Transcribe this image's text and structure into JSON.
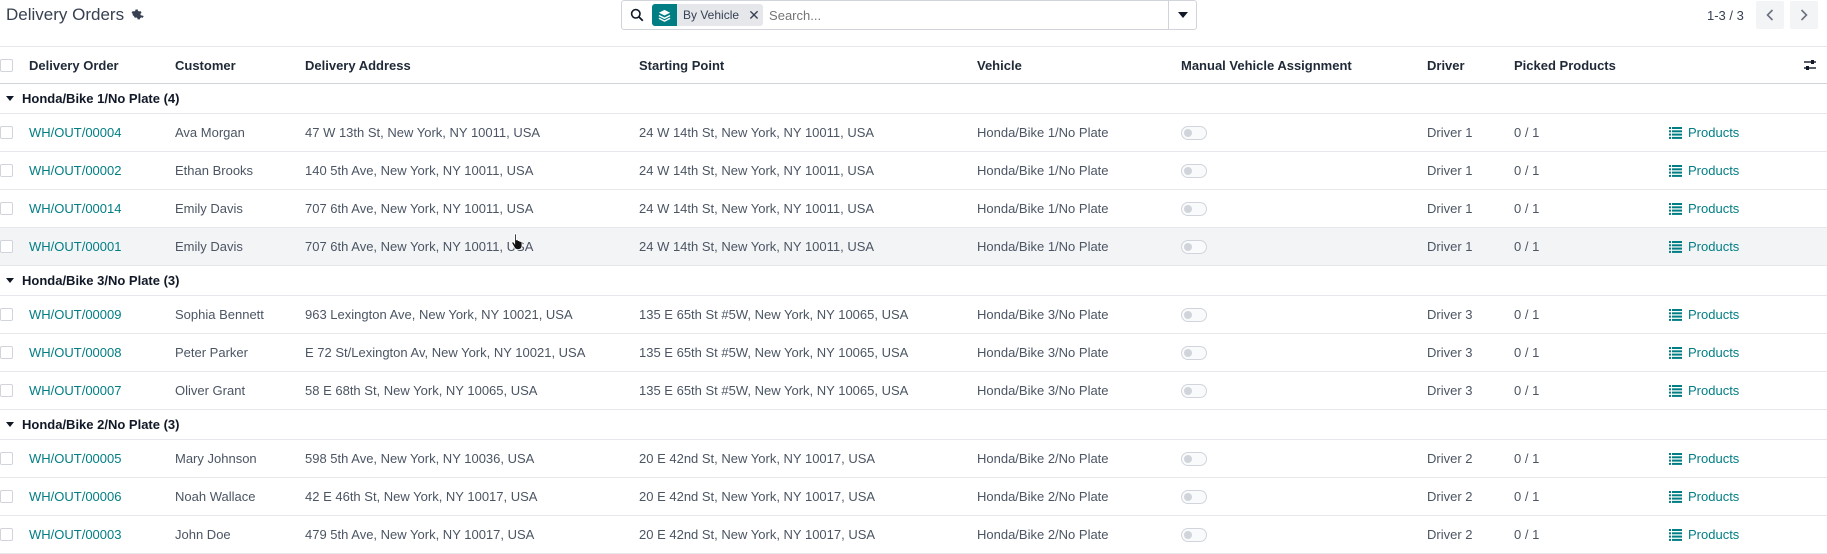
{
  "control_panel": {
    "title": "Delivery Orders",
    "search": {
      "facet_label": "By Vehicle",
      "placeholder": "Search..."
    },
    "pager": {
      "counter": "1-3 / 3"
    }
  },
  "columns": {
    "delivery_order": "Delivery Order",
    "customer": "Customer",
    "delivery_address": "Delivery Address",
    "starting_point": "Starting Point",
    "vehicle": "Vehicle",
    "manual_vehicle_assignment": "Manual Vehicle Assignment",
    "driver": "Driver",
    "picked_products": "Picked Products"
  },
  "groups": [
    {
      "label": "Honda/Bike 1/No Plate (4)",
      "rows": [
        {
          "ref": "WH/OUT/00004",
          "customer": "Ava Morgan",
          "address": "47 W 13th St, New York, NY 10011, USA",
          "start": "24 W 14th St, New York, NY 10011, USA",
          "vehicle": "Honda/Bike 1/No Plate",
          "driver": "Driver 1",
          "picked": "0 / 1",
          "products": "Products"
        },
        {
          "ref": "WH/OUT/00002",
          "customer": "Ethan Brooks",
          "address": "140 5th Ave, New York, NY 10011, USA",
          "start": "24 W 14th St, New York, NY 10011, USA",
          "vehicle": "Honda/Bike 1/No Plate",
          "driver": "Driver 1",
          "picked": "0 / 1",
          "products": "Products"
        },
        {
          "ref": "WH/OUT/00014",
          "customer": "Emily Davis",
          "address": "707 6th Ave, New York, NY 10011, USA",
          "start": "24 W 14th St, New York, NY 10011, USA",
          "vehicle": "Honda/Bike 1/No Plate",
          "driver": "Driver 1",
          "picked": "0 / 1",
          "products": "Products"
        },
        {
          "ref": "WH/OUT/00001",
          "customer": "Emily Davis",
          "address": "707 6th Ave, New York, NY 10011, USA",
          "start": "24 W 14th St, New York, NY 10011, USA",
          "vehicle": "Honda/Bike 1/No Plate",
          "driver": "Driver 1",
          "picked": "0 / 1",
          "products": "Products"
        }
      ]
    },
    {
      "label": "Honda/Bike 3/No Plate (3)",
      "rows": [
        {
          "ref": "WH/OUT/00009",
          "customer": "Sophia Bennett",
          "address": "963 Lexington Ave, New York, NY 10021, USA",
          "start": "135 E 65th St #5W, New York, NY 10065, USA",
          "vehicle": "Honda/Bike 3/No Plate",
          "driver": "Driver 3",
          "picked": "0 / 1",
          "products": "Products"
        },
        {
          "ref": "WH/OUT/00008",
          "customer": "Peter Parker",
          "address": "E 72 St/Lexington Av, New York, NY 10021, USA",
          "start": "135 E 65th St #5W, New York, NY 10065, USA",
          "vehicle": "Honda/Bike 3/No Plate",
          "driver": "Driver 3",
          "picked": "0 / 1",
          "products": "Products"
        },
        {
          "ref": "WH/OUT/00007",
          "customer": "Oliver Grant",
          "address": "58 E 68th St, New York, NY 10065, USA",
          "start": "135 E 65th St #5W, New York, NY 10065, USA",
          "vehicle": "Honda/Bike 3/No Plate",
          "driver": "Driver 3",
          "picked": "0 / 1",
          "products": "Products"
        }
      ]
    },
    {
      "label": "Honda/Bike 2/No Plate (3)",
      "rows": [
        {
          "ref": "WH/OUT/00005",
          "customer": "Mary Johnson",
          "address": "598 5th Ave, New York, NY 10036, USA",
          "start": "20 E 42nd St, New York, NY 10017, USA",
          "vehicle": "Honda/Bike 2/No Plate",
          "driver": "Driver 2",
          "picked": "0 / 1",
          "products": "Products"
        },
        {
          "ref": "WH/OUT/00006",
          "customer": "Noah Wallace",
          "address": "42 E 46th St, New York, NY 10017, USA",
          "start": "20 E 42nd St, New York, NY 10017, USA",
          "vehicle": "Honda/Bike 2/No Plate",
          "driver": "Driver 2",
          "picked": "0 / 1",
          "products": "Products"
        },
        {
          "ref": "WH/OUT/00003",
          "customer": "John Doe",
          "address": "479 5th Ave, New York, NY 10017, USA",
          "start": "20 E 42nd St, New York, NY 10017, USA",
          "vehicle": "Honda/Bike 2/No Plate",
          "driver": "Driver 2",
          "picked": "0 / 1",
          "products": "Products"
        }
      ]
    }
  ],
  "colors": {
    "accent": "#017e84",
    "text": "#374151",
    "border": "#e5e7eb"
  },
  "icons": {
    "settings": "gear-icon",
    "search": "search-icon",
    "facet": "layers-icon",
    "toggle_panel": "caret-down-icon",
    "products": "list-icon"
  }
}
